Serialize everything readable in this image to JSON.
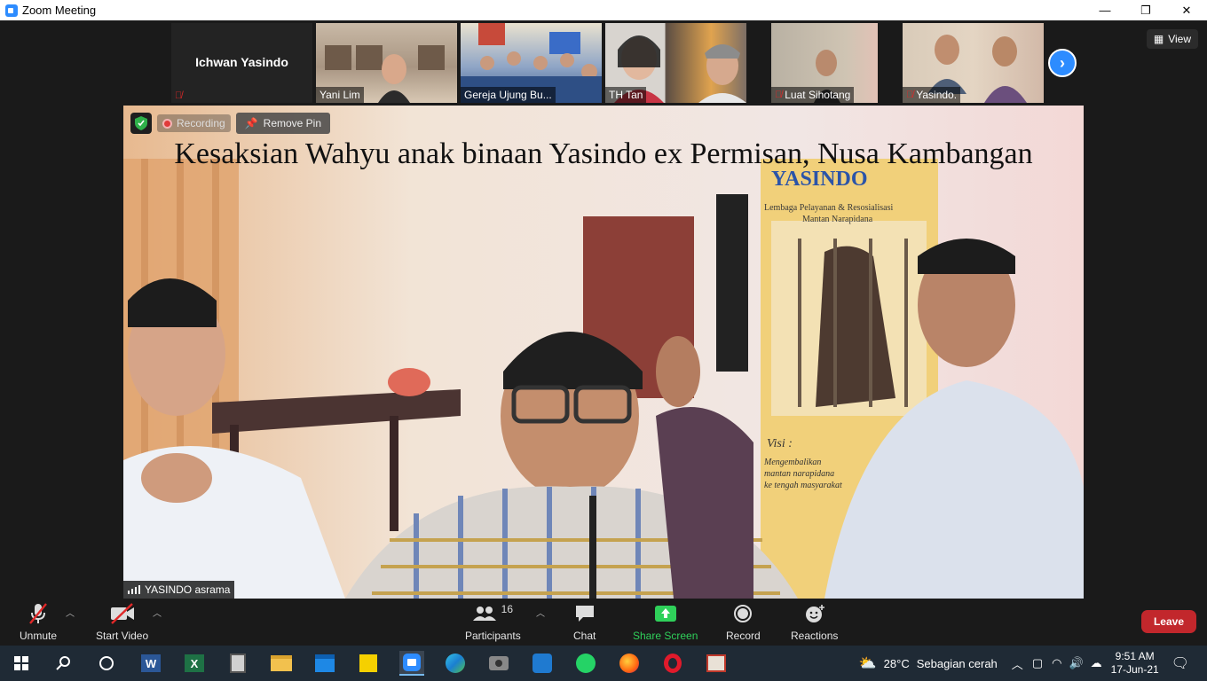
{
  "window": {
    "title": "Zoom Meeting",
    "minimize": "—",
    "restore": "❐",
    "close": "✕"
  },
  "view_button": "View",
  "participants_strip": [
    {
      "name": "Ichwan Yasindo",
      "type": "namecard",
      "muted": true
    },
    {
      "name": "Yani Lim",
      "muted": false
    },
    {
      "name": "Gereja Ujung Bu...",
      "muted": false
    },
    {
      "name": "TH Tan",
      "muted": false
    },
    {
      "name": "Luat Sihotang",
      "muted": true
    },
    {
      "name": "Yasindo.",
      "muted": true
    }
  ],
  "main_video": {
    "headline": "Kesaksian Wahyu anak binaan Yasindo ex Permisan, Nusa Kambangan",
    "recording_label": "Recording",
    "remove_pin_label": "Remove Pin",
    "speaker_label": "YASINDO asrama",
    "banner_title": "YASINDO",
    "banner_sub": "Lembaga Pelayanan & Resosialisasi Mantan Narapidana",
    "banner_visi": "Visi :",
    "banner_text": "Mengembalikan mantan narapidana ke tengah masyarakat"
  },
  "controls": {
    "unmute": "Unmute",
    "start_video": "Start Video",
    "participants": "Participants",
    "participants_count": "16",
    "chat": "Chat",
    "share_screen": "Share Screen",
    "record": "Record",
    "reactions": "Reactions",
    "leave": "Leave"
  },
  "taskbar": {
    "temperature": "28°C",
    "weather": "Sebagian cerah",
    "time": "9:51 AM",
    "date": "17-Jun-21"
  },
  "colors": {
    "accent": "#2d8cff",
    "leave": "#c2272c",
    "share": "#2fd05a",
    "muted": "#e02828"
  }
}
